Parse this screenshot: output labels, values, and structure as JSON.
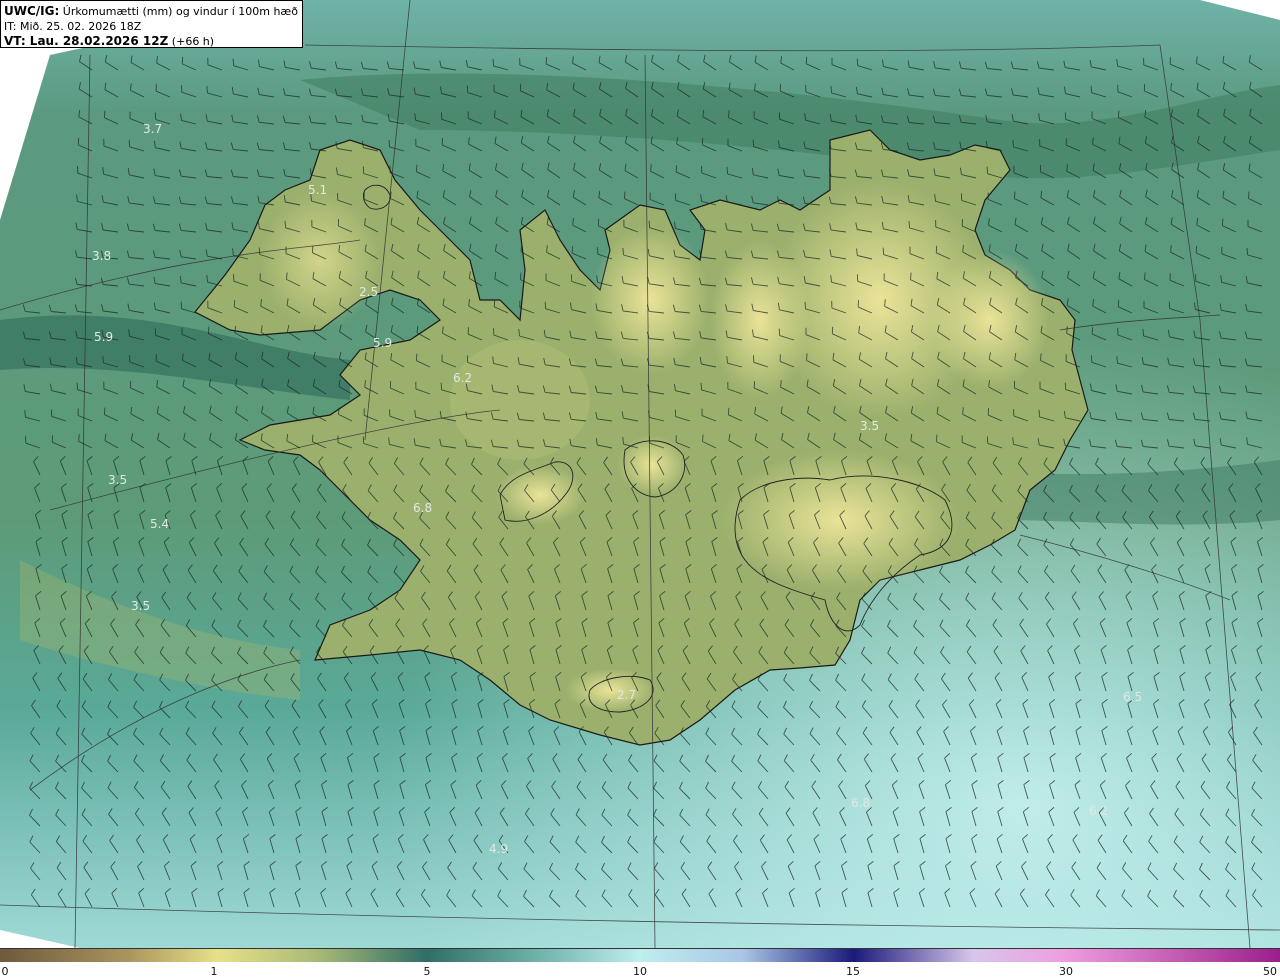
{
  "header": {
    "model": "UWC/IG:",
    "field": " Úrkomumætti (mm) og vindur í 100m hæð",
    "init_time": "IT: Mið. 25. 02. 2026 18Z",
    "valid_label": "VT: Lau. 28.02.2026 12Z",
    "lead_time": " (+66 h)"
  },
  "colorbar": {
    "ticks": [
      {
        "label": "0",
        "value": 0
      },
      {
        "label": "1",
        "value": 1
      },
      {
        "label": "5",
        "value": 5
      },
      {
        "label": "10",
        "value": 10
      },
      {
        "label": "15",
        "value": 15
      },
      {
        "label": "30",
        "value": 30
      },
      {
        "label": "50",
        "value": 50
      }
    ],
    "colors": [
      "#6e5a3c",
      "#a8955e",
      "#e8e08a",
      "#6c9a72",
      "#2f6e66",
      "#bfeeee",
      "#a9c6e6",
      "#1a1a7a",
      "#d48ad6",
      "#9a1f8a"
    ]
  },
  "map_labels": [
    {
      "text": "3.7"
    },
    {
      "text": "5.1"
    },
    {
      "text": "3.8"
    },
    {
      "text": "2.5"
    },
    {
      "text": "5.9"
    },
    {
      "text": "5.9"
    },
    {
      "text": "6.2"
    },
    {
      "text": "3.5"
    },
    {
      "text": "3.5"
    },
    {
      "text": "5.4"
    },
    {
      "text": "6.8"
    },
    {
      "text": "3.5"
    },
    {
      "text": "2.7"
    },
    {
      "text": "6.5"
    },
    {
      "text": "6.8"
    },
    {
      "text": "6.2"
    },
    {
      "text": "4.9"
    }
  ],
  "colors": {
    "ocean_deep": "#2f6e66",
    "ocean_mid": "#4f9a8c",
    "ocean_light": "#bfeeee",
    "land_low": "#8aa86a",
    "land_high": "#e6e08c",
    "coast": "#1a1a1a",
    "grid": "#333333"
  }
}
